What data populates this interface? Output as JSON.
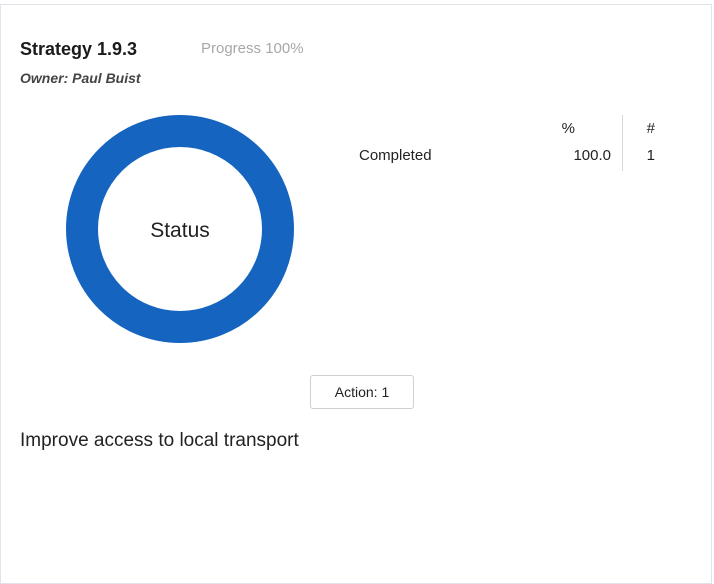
{
  "strategy": {
    "title": "Strategy 1.9.3",
    "progress_label": "Progress 100%",
    "progress_value": 1.0,
    "owner": "Owner: Paul Buist",
    "description": "Improve access to local transport"
  },
  "status_chart": {
    "center_label": "Status",
    "ring_color": "#1565c0",
    "segments": [
      {
        "label": "Completed",
        "fraction": 1.0
      }
    ]
  },
  "status_table": {
    "header_pct": "%",
    "header_count": "#",
    "rows": [
      {
        "label": "Completed",
        "pct": "100.0",
        "count": "1"
      }
    ]
  },
  "actions": {
    "button_label": "Action: 1"
  }
}
